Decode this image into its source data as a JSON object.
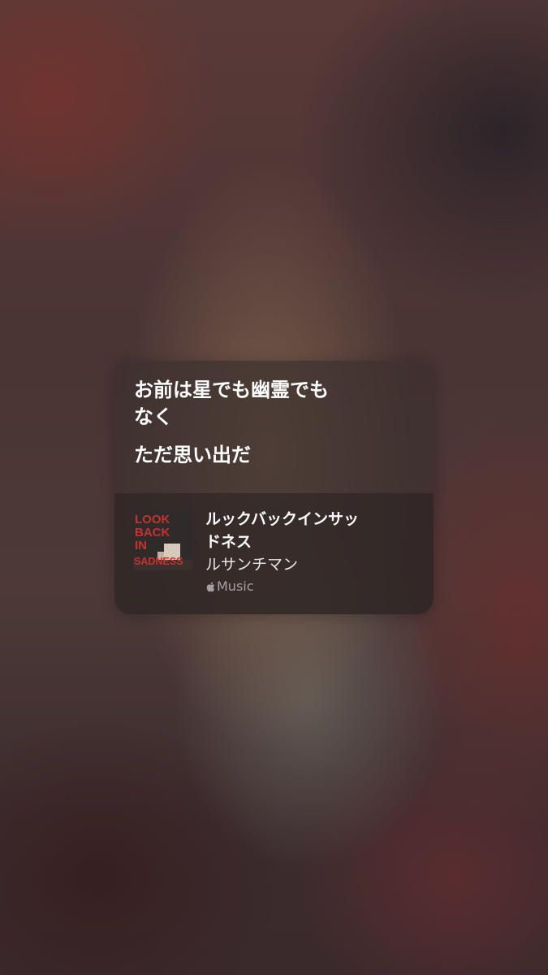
{
  "card": {
    "lyrics": [
      "お前は星でも幽霊でも\nなく",
      "ただ思い出だ"
    ],
    "lyric_line_1a": "お前は星でも幽霊でも",
    "lyric_line_1b": "なく",
    "lyric_line_2": "ただ思い出だ"
  },
  "track": {
    "title_line_1": "ルックバックインサッ",
    "title_line_2": "ドネス",
    "artist": "ルサンチマン",
    "service": "Music",
    "album_art_text": [
      "LOOK",
      "BACK",
      "IN",
      "SADNESS"
    ]
  },
  "colors": {
    "album_text_red": "#c8312f",
    "card_bg": "#3c302e"
  },
  "icons": {
    "service_logo": "apple-logo-icon"
  }
}
